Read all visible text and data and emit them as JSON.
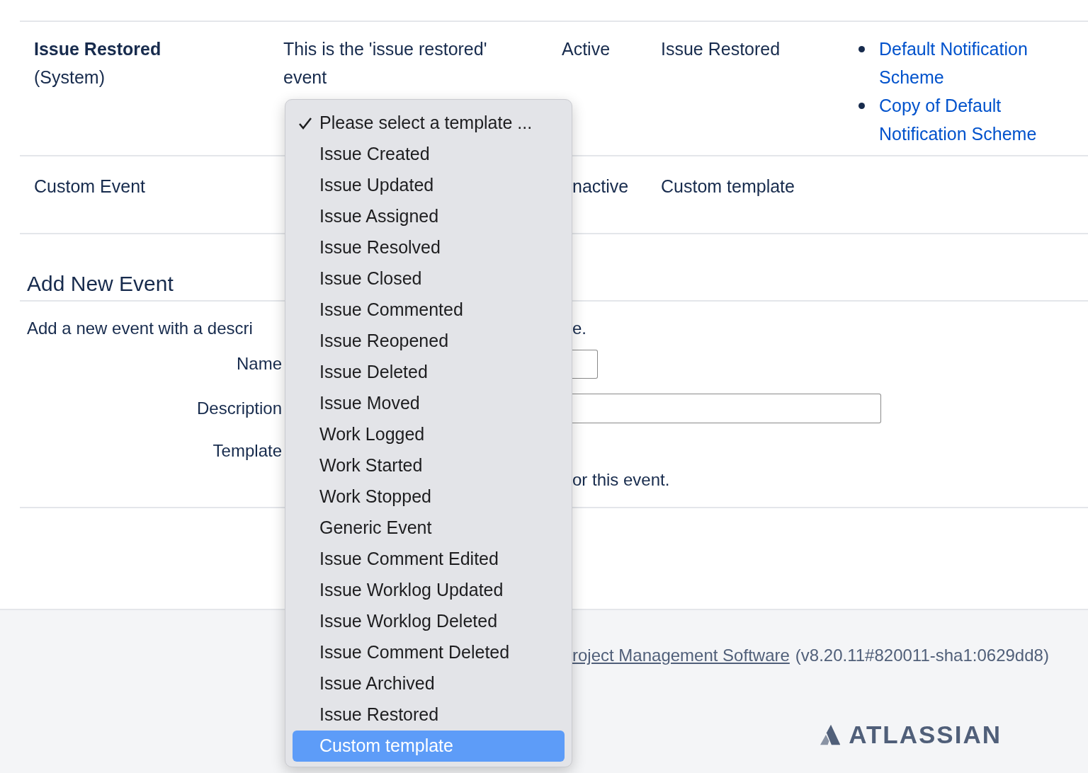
{
  "table_rows": [
    {
      "name": "Issue Restored",
      "name_note": "(System)",
      "description": "This is the 'issue restored' event",
      "status": "Active",
      "template": "Issue Restored",
      "schemes": [
        "Default Notification Scheme",
        "Copy of Default Notification Scheme"
      ]
    },
    {
      "name": "Custom Event",
      "status": "nactive",
      "template": "Custom template"
    }
  ],
  "add_event": {
    "heading": "Add New Event",
    "intro_left": "Add a new event with a descri",
    "intro_right": "e.",
    "fields": [
      {
        "label": "Name",
        "kind": "short"
      },
      {
        "label": "Description",
        "kind": "long"
      },
      {
        "label": "Template",
        "kind": "select"
      }
    ],
    "template_hint": "or this event."
  },
  "footer": {
    "link": "roject Management Software",
    "version": "(v8.20.11#820011-sha1:0629dd8)",
    "logo": "ATLASSIAN"
  },
  "dropdown": {
    "options": [
      {
        "label": "Please select a template ...",
        "checked": true,
        "selected": false
      },
      {
        "label": "Issue Created",
        "checked": false,
        "selected": false
      },
      {
        "label": "Issue Updated",
        "checked": false,
        "selected": false
      },
      {
        "label": "Issue Assigned",
        "checked": false,
        "selected": false
      },
      {
        "label": "Issue Resolved",
        "checked": false,
        "selected": false
      },
      {
        "label": "Issue Closed",
        "checked": false,
        "selected": false
      },
      {
        "label": "Issue Commented",
        "checked": false,
        "selected": false
      },
      {
        "label": "Issue Reopened",
        "checked": false,
        "selected": false
      },
      {
        "label": "Issue Deleted",
        "checked": false,
        "selected": false
      },
      {
        "label": "Issue Moved",
        "checked": false,
        "selected": false
      },
      {
        "label": "Work Logged",
        "checked": false,
        "selected": false
      },
      {
        "label": "Work Started",
        "checked": false,
        "selected": false
      },
      {
        "label": "Work Stopped",
        "checked": false,
        "selected": false
      },
      {
        "label": "Generic Event",
        "checked": false,
        "selected": false
      },
      {
        "label": "Issue Comment Edited",
        "checked": false,
        "selected": false
      },
      {
        "label": "Issue Worklog Updated",
        "checked": false,
        "selected": false
      },
      {
        "label": "Issue Worklog Deleted",
        "checked": false,
        "selected": false
      },
      {
        "label": "Issue Comment Deleted",
        "checked": false,
        "selected": false
      },
      {
        "label": "Issue Archived",
        "checked": false,
        "selected": false
      },
      {
        "label": "Issue Restored",
        "checked": false,
        "selected": false
      },
      {
        "label": "Custom template",
        "checked": false,
        "selected": true
      }
    ]
  }
}
